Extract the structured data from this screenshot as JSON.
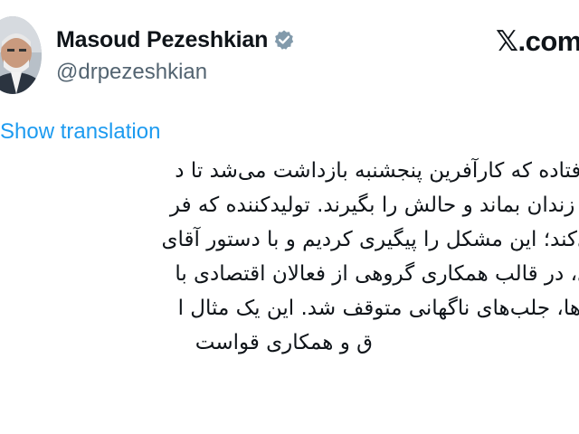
{
  "author": {
    "display_name": "Masoud Pezeshkian",
    "handle": "@drpezeshkian",
    "verified": true
  },
  "brand": {
    "label": "𝕏.com"
  },
  "translation": {
    "label": "Show translation"
  },
  "tweet": {
    "lines": [
      "ق افتاده که کارآفرین پنجشنبه بازداشت می‌شد تا د",
      "در زندان بماند و حالش را بگیرند. تولیدکننده که فر",
      "ی‌کند؛ این مشکل را پیگیری کردیم و با دستور آقای",
      "ی، در قالب همکاری گروهی از فعالان اقتصادی با",
      "گاه‌ها، جلب‌های ناگهانی متوقف شد. این یک مثال ا",
      "ق و همکاری قواست"
    ]
  },
  "colors": {
    "text_primary": "#0f1419",
    "text_secondary": "#536471",
    "link": "#1d9bf0",
    "verified_badge": "#829aab"
  },
  "icons": {
    "verified": "verified-badge-icon",
    "avatar": "profile-photo"
  }
}
